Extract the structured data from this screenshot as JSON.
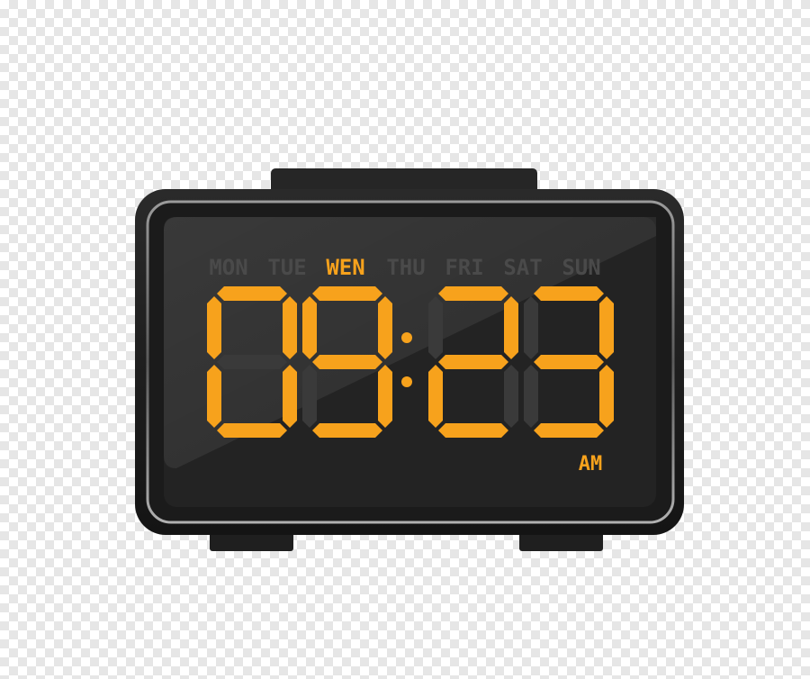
{
  "clock": {
    "time": "09:23",
    "hours": "09",
    "minutes": "23",
    "meridiem": "AM",
    "days": [
      "MON",
      "TUE",
      "WEN",
      "THU",
      "FRI",
      "SAT",
      "SUN"
    ],
    "active_day": "WEN"
  },
  "colors": {
    "segment_on": "#f7a21c",
    "segment_off": "#3a3a3a",
    "day_off": "#4a4a4a",
    "screen": "#232323",
    "body": "#1a1a1a",
    "bezel": "#8c8c8c"
  }
}
